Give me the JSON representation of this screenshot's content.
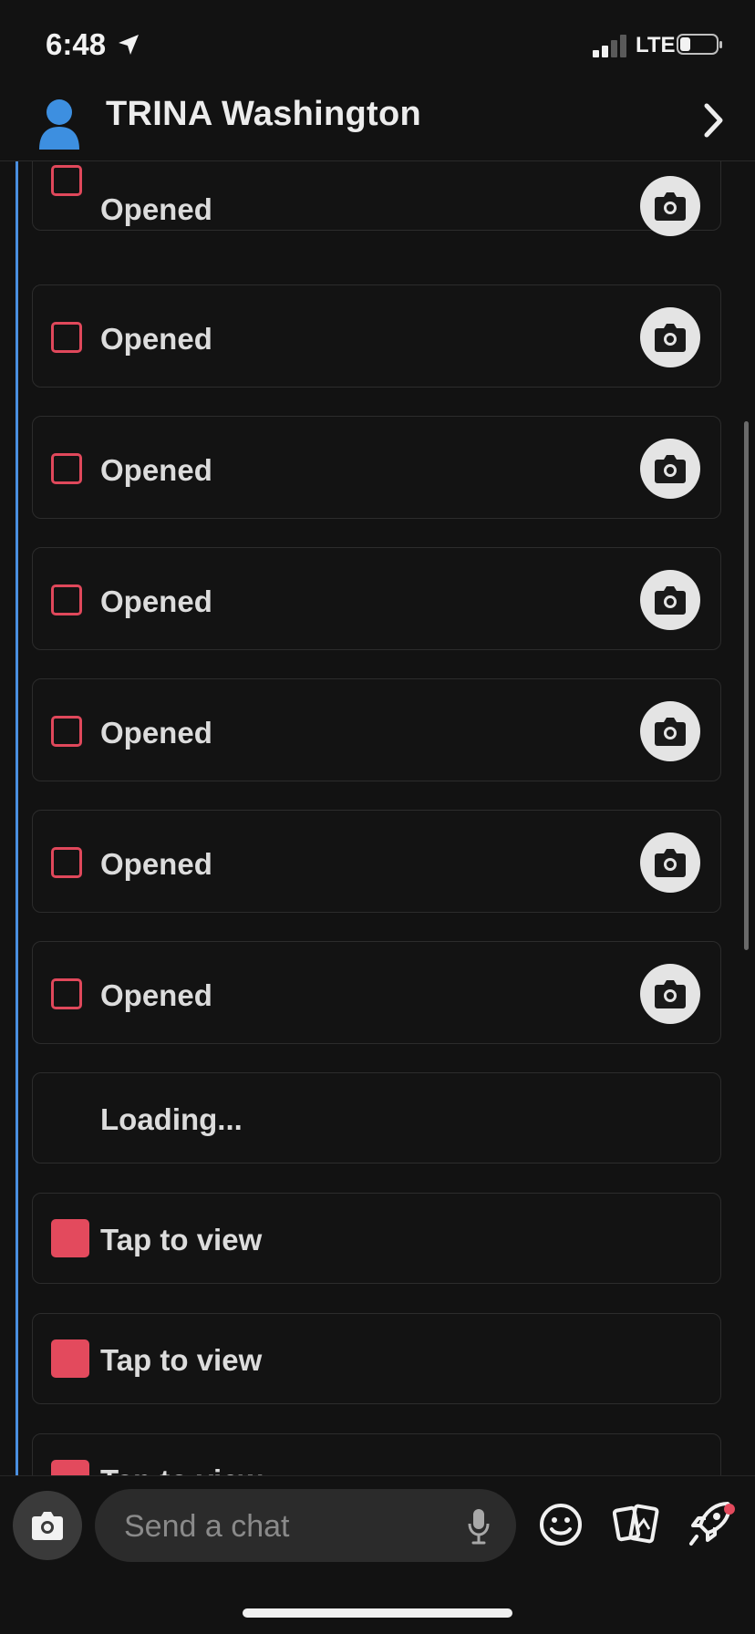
{
  "status_bar": {
    "time": "6:48",
    "network": "LTE",
    "icons": [
      "location-arrow-icon",
      "signal-icon",
      "battery-icon"
    ]
  },
  "header": {
    "contact_name": "TRINA Washington",
    "avatar_icon": "person-icon",
    "action_icon": "chevron-right-icon"
  },
  "messages": [
    {
      "status": "Opened",
      "type": "opened"
    },
    {
      "status": "Opened",
      "type": "opened"
    },
    {
      "status": "Opened",
      "type": "opened"
    },
    {
      "status": "Opened",
      "type": "opened"
    },
    {
      "status": "Opened",
      "type": "opened"
    },
    {
      "status": "Opened",
      "type": "opened"
    },
    {
      "status": "Opened",
      "type": "opened"
    },
    {
      "status": "Loading...",
      "type": "loading"
    },
    {
      "status": "Tap to view",
      "type": "new"
    },
    {
      "status": "Tap to view",
      "type": "new"
    },
    {
      "status": "Tap to view",
      "type": "new"
    }
  ],
  "composer": {
    "placeholder": "Send a chat",
    "icons": [
      "camera-icon",
      "microphone-icon",
      "emoji-icon",
      "cards-icon",
      "rocket-icon"
    ]
  },
  "colors": {
    "accent_red": "#e34a5d",
    "thread_blue": "#4a8fe0",
    "background": "#121212"
  }
}
